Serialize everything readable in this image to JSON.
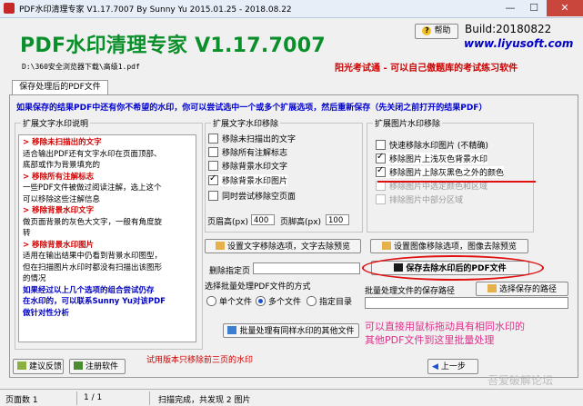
{
  "window": {
    "title": "PDF水印清理专家 V1.17.7007 By Sunny Yu 2015.01.25 - 2018.08.22",
    "controls": {
      "minimize": "—",
      "maximize": "☐",
      "close": "✕"
    }
  },
  "header": {
    "app_title": "PDF水印清理专家 V1.17.7007",
    "file_path": "D:\\360安全浏览器下载\\高级1.pdf",
    "help_label": "帮助",
    "build": "Build:20180822",
    "website": "www.liyusoft.com",
    "slogan": "阳光考试通 - 可以自己傲题库的考试练习软件"
  },
  "tab": {
    "label": "保存处理后的PDF文件"
  },
  "instruction": "如果保存的结果PDF中还有你不希望的水印，你可以尝试选中一个或多个扩展选项，然后重新保存（先关闭之前打开的结果PDF）",
  "desc_group": {
    "label": "扩展文字水印说明",
    "lines": [
      {
        "style": "h",
        "text": "> 移除未扫描出的文字"
      },
      {
        "style": "n",
        "text": "  适合输出PDF还有文字水印在页面顶部、"
      },
      {
        "style": "n",
        "text": "底部或作为背景填充的"
      },
      {
        "style": "h",
        "text": "> 移除所有注解标志"
      },
      {
        "style": "n",
        "text": "  一些PDF文件被做过阅读注解，选上这个"
      },
      {
        "style": "n",
        "text": "可以移除这些注解信息"
      },
      {
        "style": "h",
        "text": "> 移除背景水印文字"
      },
      {
        "style": "n",
        "text": "  做页面背景的灰色大文字，一般有角度旋"
      },
      {
        "style": "n",
        "text": "转"
      },
      {
        "style": "h",
        "text": "> 移除背景水印图片"
      },
      {
        "style": "n",
        "text": "  适用在输出结果中仍看到背景水印图型，"
      },
      {
        "style": "n",
        "text": "但在扫描图片水印时都没有扫描出该图形"
      },
      {
        "style": "n",
        "text": "的情况"
      },
      {
        "style": "b",
        "text": "如果经过以上几个选项的组合尝试仍存"
      },
      {
        "style": "b",
        "text": "在水印的，可以联系Sunny Yu对该PDF"
      },
      {
        "style": "b",
        "text": "做针对性分析"
      }
    ]
  },
  "text_group": {
    "label": "扩展文字水印移除",
    "options": [
      {
        "label": "移除未扫描出的文字",
        "checked": false
      },
      {
        "label": "移除所有注解标志",
        "checked": false
      },
      {
        "label": "移除背景水印文字",
        "checked": false
      },
      {
        "label": "移除背景水印图片",
        "checked": true
      },
      {
        "label": "同时尝试移除空页面",
        "checked": false
      }
    ],
    "header_label": "页眉高(px)",
    "header_value": "400",
    "footer_label": "页脚高(px)",
    "footer_value": "100"
  },
  "image_group": {
    "label": "扩展图片水印移除",
    "options": [
      {
        "label": "快速移除水印图片 (不精确)",
        "checked": false,
        "disabled": false
      },
      {
        "label": "移除图片上浅灰色背景水印",
        "checked": true,
        "disabled": false
      },
      {
        "label": "移除图片上除灰黑色之外的颜色",
        "checked": true,
        "disabled": false
      },
      {
        "label": "移除图片中选定颜色和区域",
        "checked": false,
        "disabled": true
      },
      {
        "label": "排除图片中部分区域",
        "checked": false,
        "disabled": true
      }
    ]
  },
  "buttons": {
    "set_text": "设置文字移除选项，文字去除预览",
    "set_image": "设置图像移除选项，图像去除预览",
    "delete_pages_label": "删除指定页",
    "save": "保存去除水印后的PDF文件",
    "batch_same": "批量处理有同样水印的其他文件",
    "save_path_label": "批量处理文件的保存路径",
    "choose_path": "选择保存的路径",
    "feedback": "建议反馈",
    "register": "注册软件",
    "prev": "上一步"
  },
  "batch_mode": {
    "label": "选择批量处理PDF文件的方式",
    "options": [
      {
        "label": "单个文件",
        "selected": false
      },
      {
        "label": "多个文件",
        "selected": true
      },
      {
        "label": "指定目录",
        "selected": false
      }
    ]
  },
  "trial_note": "试用版本只移除前三页的水印",
  "drag_note_1": "可以直接用鼠标拖动具有相同水印的",
  "drag_note_2": "其他PDF文件到这里批量处理",
  "status": {
    "page_label": "页面数 1",
    "page_index": "1 / 1",
    "scan_result": "扫描完成，共发现 2 图片"
  },
  "watermark_text": "吾爱破解论坛",
  "colors": {
    "title_green": "#0a8f2a",
    "link_blue": "#0000c8",
    "alert_red": "#cc0000",
    "note_pink": "#e0308a"
  }
}
